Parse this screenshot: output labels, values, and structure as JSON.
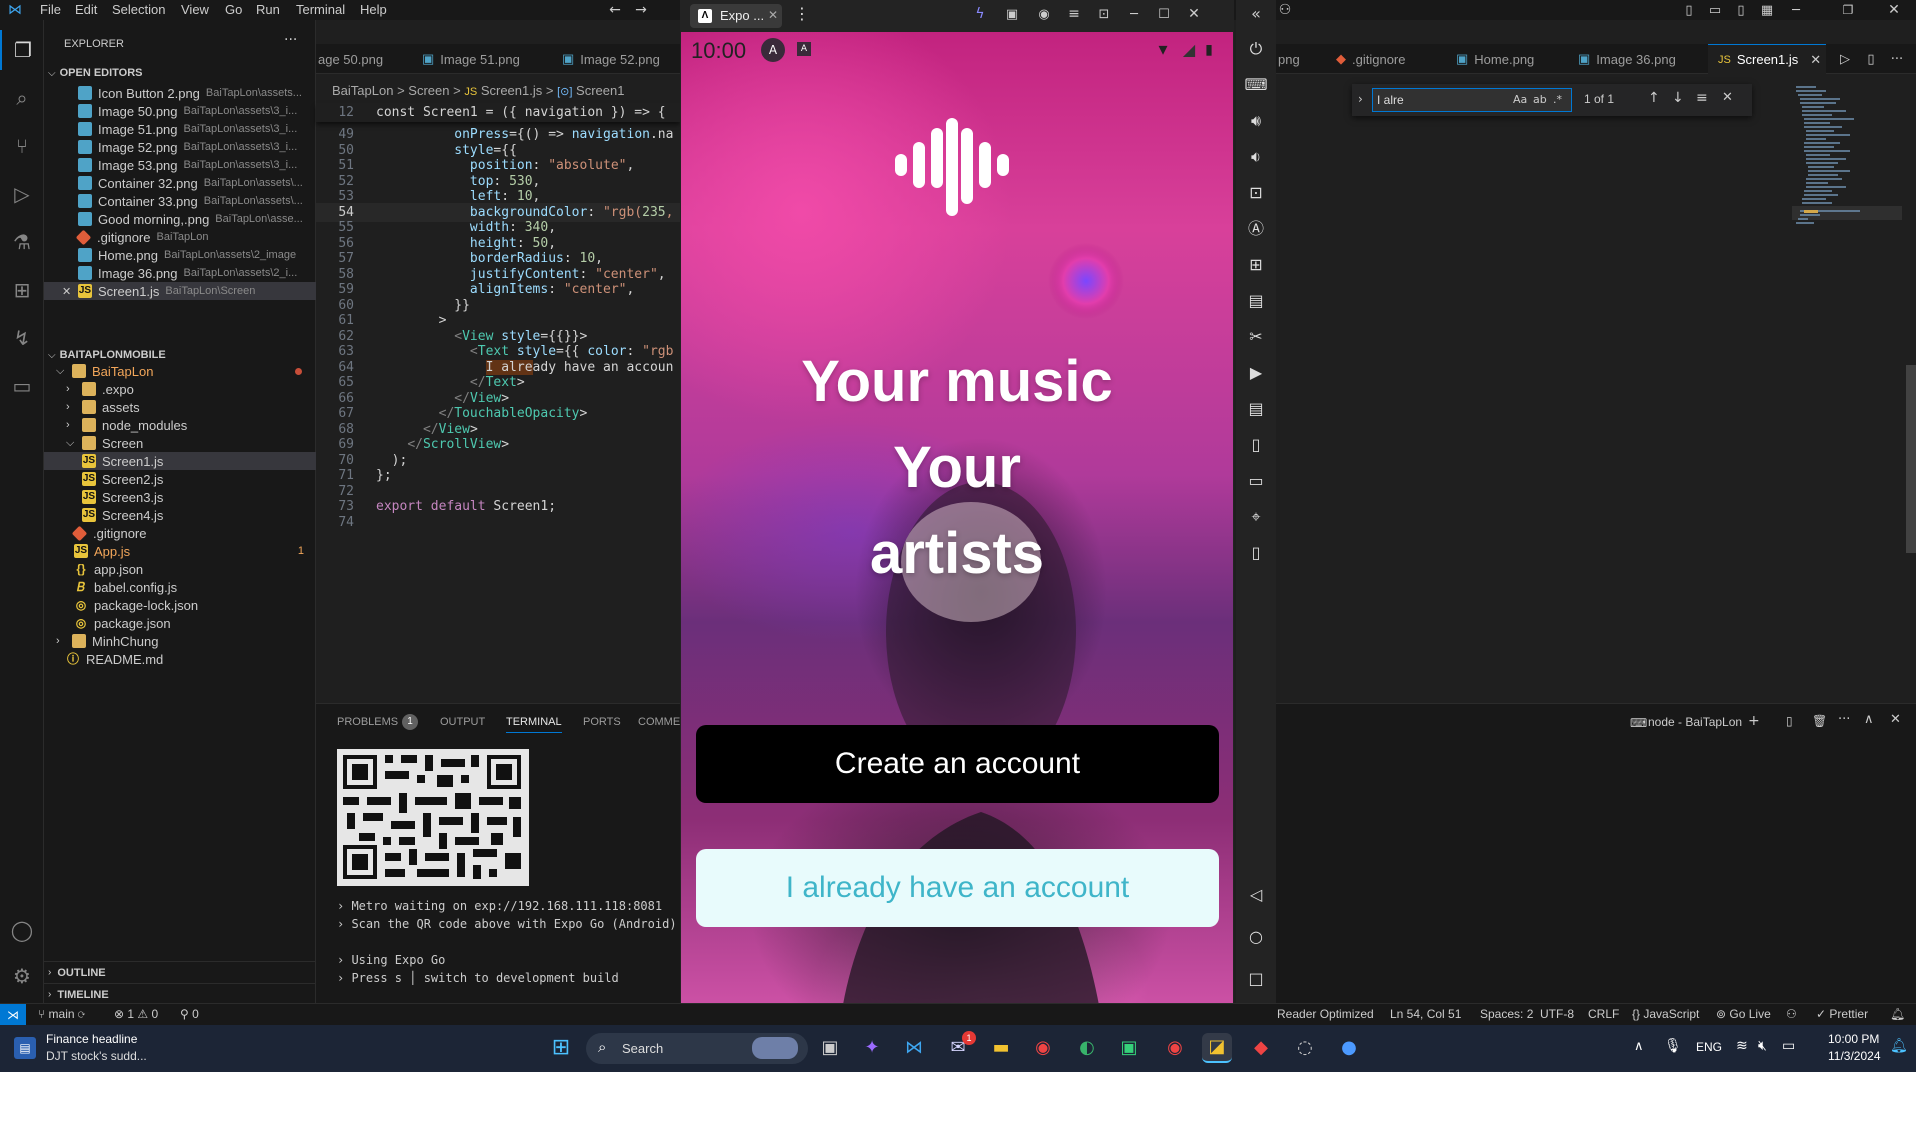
{
  "menu": [
    "File",
    "Edit",
    "Selection",
    "View",
    "Go",
    "Run",
    "Terminal",
    "Help"
  ],
  "sidebar": {
    "title": "EXPLORER",
    "open_editors": "OPEN EDITORS",
    "editors": [
      {
        "name": "Icon Button 2.png",
        "path": "BaiTapLon\\assets..."
      },
      {
        "name": "Image 50.png",
        "path": "BaiTapLon\\assets\\3_i..."
      },
      {
        "name": "Image 51.png",
        "path": "BaiTapLon\\assets\\3_i..."
      },
      {
        "name": "Image 52.png",
        "path": "BaiTapLon\\assets\\3_i..."
      },
      {
        "name": "Image 53.png",
        "path": "BaiTapLon\\assets\\3_i..."
      },
      {
        "name": "Container 32.png",
        "path": "BaiTapLon\\assets\\..."
      },
      {
        "name": "Container 33.png",
        "path": "BaiTapLon\\assets\\..."
      },
      {
        "name": "Good morning,.png",
        "path": "BaiTapLon\\asse..."
      },
      {
        "name": ".gitignore",
        "path": "BaiTapLon"
      },
      {
        "name": "Home.png",
        "path": "BaiTapLon\\assets\\2_image"
      },
      {
        "name": "Image 36.png",
        "path": "BaiTapLon\\assets\\2_i..."
      },
      {
        "name": "Screen1.js",
        "path": "BaiTapLon\\Screen"
      }
    ],
    "project": "BAITAPLONMOBILE",
    "tree": [
      "BaiTapLon",
      ".expo",
      "assets",
      "node_modules",
      "Screen",
      "Screen1.js",
      "Screen2.js",
      "Screen3.js",
      "Screen4.js",
      ".gitignore",
      "App.js",
      "app.json",
      "babel.config.js",
      "package-lock.json",
      "package.json",
      "MinhChung",
      "README.md"
    ],
    "app_badge": "1",
    "outline": "OUTLINE",
    "timeline": "TIMELINE"
  },
  "editor": {
    "tabs": [
      "age 50.png",
      "Image 51.png",
      "Image 52.png"
    ],
    "breadcrumb": [
      "BaiTapLon",
      ">",
      "Screen",
      ">",
      "Screen1.js",
      ">",
      "Screen1"
    ],
    "sticky": "const Screen1 = ({ navigation }) => {",
    "sticky_ln": "12",
    "lines": [
      {
        "n": "49",
        "t": "          onPress={() => navigation.na"
      },
      {
        "n": "50",
        "t": "          style={{"
      },
      {
        "n": "51",
        "t": "            position: \"absolute\","
      },
      {
        "n": "52",
        "t": "            top: 530,"
      },
      {
        "n": "53",
        "t": "            left: 10,"
      },
      {
        "n": "54",
        "t": "            backgroundColor: \"rgb(235,"
      },
      {
        "n": "55",
        "t": "            width: 340,"
      },
      {
        "n": "56",
        "t": "            height: 50,"
      },
      {
        "n": "57",
        "t": "            borderRadius: 10,"
      },
      {
        "n": "58",
        "t": "            justifyContent: \"center\","
      },
      {
        "n": "59",
        "t": "            alignItems: \"center\","
      },
      {
        "n": "60",
        "t": "          }}"
      },
      {
        "n": "61",
        "t": "        >"
      },
      {
        "n": "62",
        "t": "          <View style={{}}>"
      },
      {
        "n": "63",
        "t": "            <Text style={{ color: \"rgb"
      },
      {
        "n": "64",
        "t": "              I already have an accoun"
      },
      {
        "n": "65",
        "t": "            </Text>"
      },
      {
        "n": "66",
        "t": "          </View>"
      },
      {
        "n": "67",
        "t": "        </TouchableOpacity>"
      },
      {
        "n": "68",
        "t": "      </View>"
      },
      {
        "n": "69",
        "t": "    </ScrollView>"
      },
      {
        "n": "70",
        "t": "  );"
      },
      {
        "n": "71",
        "t": "};"
      },
      {
        "n": "72",
        "t": ""
      },
      {
        "n": "73",
        "t": "export default Screen1;"
      },
      {
        "n": "74",
        "t": ""
      }
    ]
  },
  "panel": {
    "tabs": [
      "PROBLEMS",
      "OUTPUT",
      "TERMINAL",
      "PORTS",
      "COMME"
    ],
    "problems_count": "1",
    "lines": [
      "› Metro waiting on exp://192.168.111.118:8081",
      "› Scan the QR code above with Expo Go (Android) o",
      "",
      "› Using Expo Go",
      "› Press s │ switch to development build"
    ]
  },
  "emulator": {
    "title": "Expo ...",
    "clock": "10:00",
    "headline1": "Your music",
    "headline2": "Your",
    "headline3": "artists",
    "create_btn": "Create an account",
    "login_btn": "I already have an account"
  },
  "right": {
    "tabs": [
      "png",
      ".gitignore",
      "Home.png",
      "Image 36.png",
      "Screen1.js"
    ],
    "find_value": "I alre",
    "find_count": "1 of 1",
    "terminal_name": "node - BaiTapLon"
  },
  "status": {
    "branch": "main",
    "errors": "1",
    "warnings": "0",
    "ports": "0",
    "reader": "Reader Optimized",
    "position": "Ln 54, Col 51",
    "spaces": "Spaces: 2",
    "encoding": "UTF-8",
    "eol": "CRLF",
    "language": "JavaScript",
    "golive": "Go Live",
    "prettier": "Prettier"
  },
  "taskbar": {
    "weather_title": "Finance headline",
    "weather_sub": "DJT stock's sudd...",
    "search": "Search",
    "lang": "ENG",
    "time": "10:00 PM",
    "date": "11/3/2024",
    "mail_badge": "1"
  }
}
